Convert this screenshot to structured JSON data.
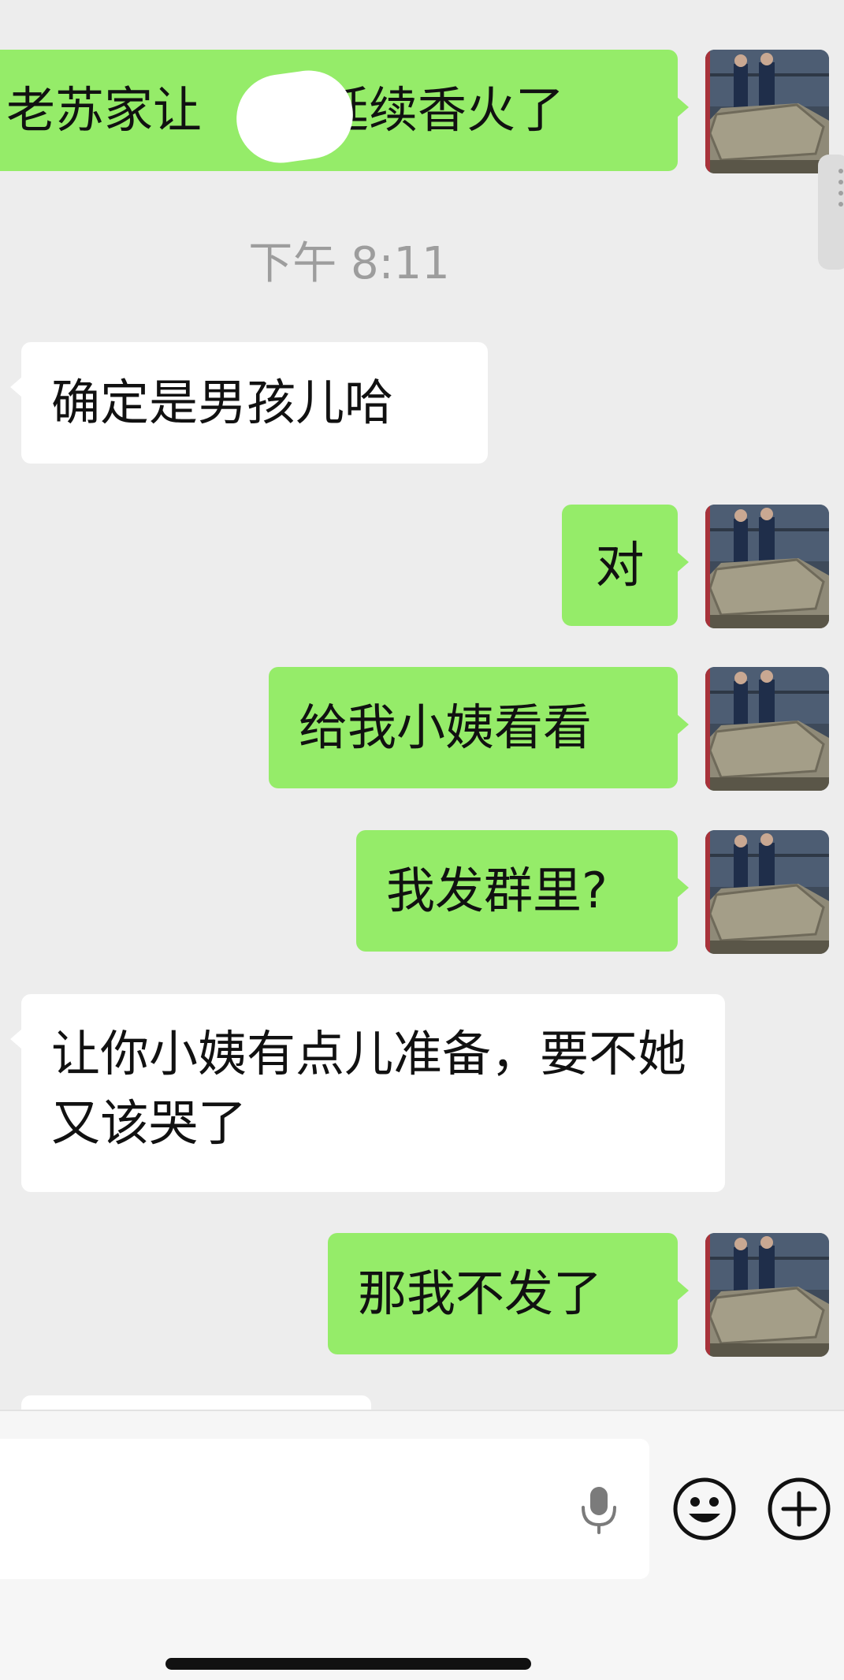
{
  "chat": {
    "messages": [
      {
        "direction": "outgoing",
        "text": "老苏家让",
        "text_suffix": "延续香火了",
        "redacted": true
      },
      {
        "direction": "outgoing",
        "text": "对"
      },
      {
        "direction": "outgoing",
        "text": "给我小姨看看"
      },
      {
        "direction": "outgoing",
        "text": "我发群里?"
      },
      {
        "direction": "outgoing",
        "text": "那我不发了"
      },
      {
        "direction": "incoming",
        "text": "确定是男孩儿哈"
      },
      {
        "direction": "incoming",
        "text": "让你小姨有点儿准备，要不她又该哭了"
      }
    ],
    "timestamp": "下午 8:11"
  },
  "input_bar": {
    "value": "",
    "placeholder": "",
    "voice_icon": "microphone-icon",
    "emoji_icon": "smiley-face-icon",
    "more_icon": "plus-circle-icon"
  },
  "colors": {
    "outgoing_bubble": "#95ec69",
    "incoming_bubble": "#ffffff",
    "background": "#ededed",
    "timestamp_text": "#9d9d9d"
  }
}
